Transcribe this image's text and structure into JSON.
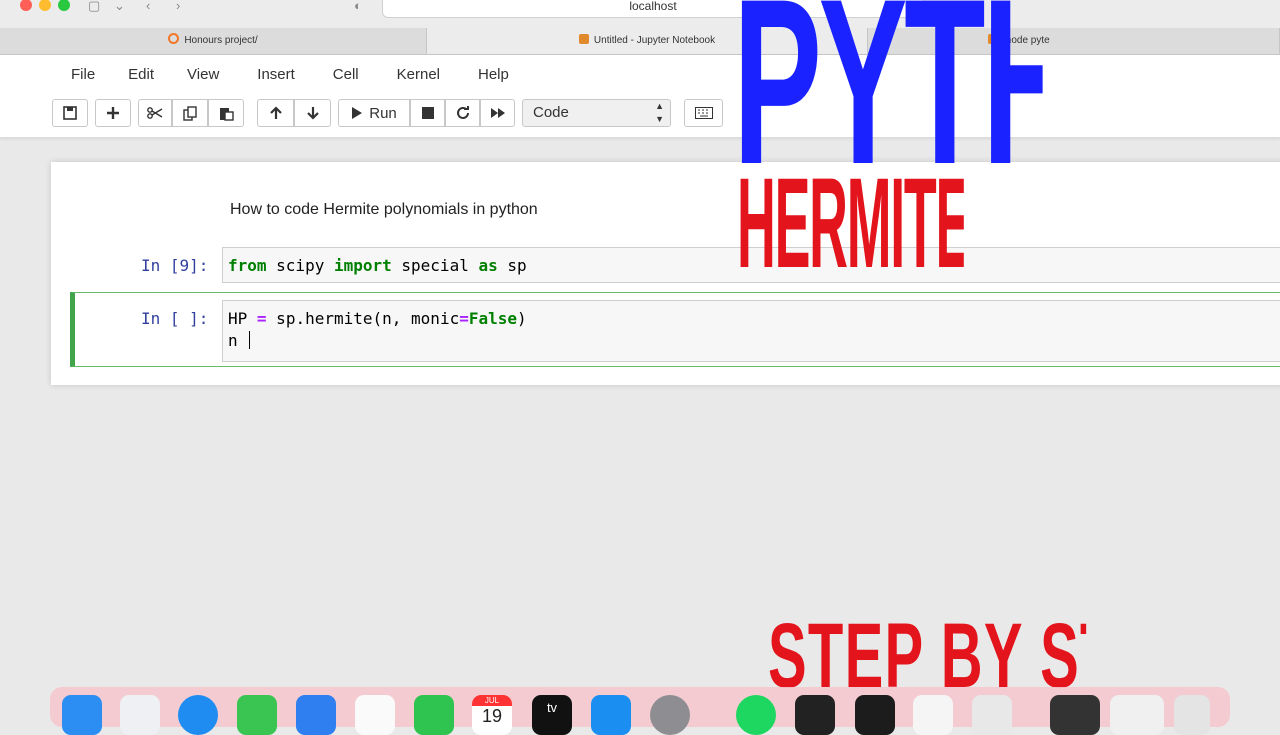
{
  "browser": {
    "address": "localhost",
    "tabs": [
      "Honours project/",
      "Untitled - Jupyter Notebook",
      "mode",
      "pyte"
    ]
  },
  "menu": [
    "File",
    "Edit",
    "View",
    "Insert",
    "Cell",
    "Kernel",
    "Help"
  ],
  "toolbar": {
    "run_label": "Run",
    "cell_type": "Code",
    "icons": [
      "save-icon",
      "plus-icon",
      "cut-icon",
      "copy-icon",
      "paste-icon",
      "arrow-up-icon",
      "arrow-down-icon",
      "play-icon",
      "stop-icon",
      "restart-icon",
      "fast-forward-icon",
      "keyboard-icon"
    ]
  },
  "cells": {
    "markdown": "How to code Hermite polynomials in python",
    "cell1": {
      "prompt": "In [9]:",
      "code": {
        "t1": "from",
        "t2": " scipy ",
        "t3": "import",
        "t4": " special ",
        "t5": "as",
        "t6": " sp"
      }
    },
    "cell2": {
      "prompt": "In [ ]:",
      "line1": {
        "t1": "HP ",
        "t2": "=",
        "t3": " sp.hermite(n, monic",
        "t4": "=",
        "t5": "False",
        "t6": ")"
      },
      "line2": "n "
    }
  },
  "overlay": {
    "title": "PYTHON",
    "subtitle": "HERMITE POLYNOMIALS",
    "footer": "STEP BY STEP"
  },
  "dock": {
    "calendar_month": "JUL",
    "calendar_day": "19",
    "tv_label": "tv"
  },
  "colors": {
    "overlay_blue": "#1a23ff",
    "overlay_red": "#e3141b",
    "selected_cell_green": "#42a549",
    "prompt_blue": "#303f9f"
  }
}
